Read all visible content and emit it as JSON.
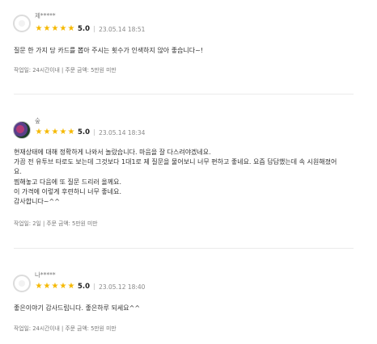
{
  "reviews": [
    {
      "name": "제*****",
      "rating": "5.0",
      "stars": 5,
      "date": "23.05.14 18:51",
      "lines": [
        "질문 한 가지 당 카드를 뽑아 주시는 횟수가 인색하지 않아 좋습니다~!"
      ],
      "info": "작업일: 24시간이내 | 주문 금액: 5만원 미만"
    },
    {
      "name": "숲",
      "rating": "5.0",
      "stars": 5,
      "date": "23.05.14 18:34",
      "lines": [
        "현재상태에 대해 정확하게 나와서 놀랐습니다. 마음을 잘 다스려야겠네요.",
        "가끔 전 유투브 타로도 보는데 그것보다 1대1로 제 질문을 물어보니 너무 편하고 좋네요. 요즘 답답했는데 속 시원해졌어",
        "요.",
        "찜해놓고 다음에 또 질문 드리러 올께요.",
        "이 가격에 이렇게 후련하니 너무 좋네요.",
        "감사합니다~^^"
      ],
      "info": "작업일: 2일 | 주문 금액: 5만원 미만"
    },
    {
      "name": "나*****",
      "rating": "5.0",
      "stars": 5,
      "date": "23.05.12 18:40",
      "lines": [
        "좋은이야기 감사드립니다. 좋은하루 되세요^^"
      ],
      "info": "작업일: 24시간이내 | 주문 금액: 5만원 미만"
    }
  ],
  "icons": {
    "star": "star-icon",
    "avatar_default": "default-avatar-icon"
  },
  "colors": {
    "star": "#f5b800",
    "divider": "#ebebeb"
  }
}
